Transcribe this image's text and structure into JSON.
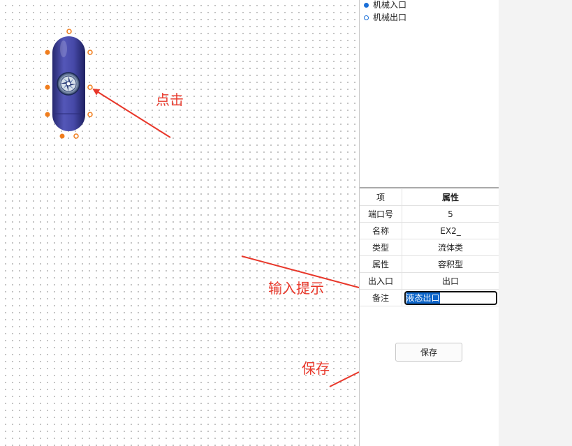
{
  "canvas": {
    "component_icons": [
      "tank-capsule-icon",
      "fan-wheel-icon"
    ],
    "annotations": {
      "click": "点击",
      "input_hint": "输入提示",
      "save": "保存"
    }
  },
  "port_list": {
    "items": [
      {
        "label": "机械入口",
        "marker": "filled"
      },
      {
        "label": "机械出口",
        "marker": "hollow"
      }
    ]
  },
  "properties": {
    "header": {
      "key": "项",
      "value": "属性"
    },
    "rows": [
      {
        "key": "端口号",
        "value": "5"
      },
      {
        "key": "名称",
        "value": "EX2_"
      },
      {
        "key": "类型",
        "value": "流体类"
      },
      {
        "key": "属性",
        "value": "容积型"
      },
      {
        "key": "出入口",
        "value": "出口"
      },
      {
        "key": "备注",
        "value": "液态出口"
      }
    ]
  },
  "save_button": {
    "label": "保存"
  },
  "colors": {
    "accent_blue": "#1a6fd8",
    "annotation_red": "#e8372a",
    "handle_orange": "#f07d1c",
    "tank_purple": "#3b3d9c",
    "selection_blue": "#0a63c8"
  }
}
